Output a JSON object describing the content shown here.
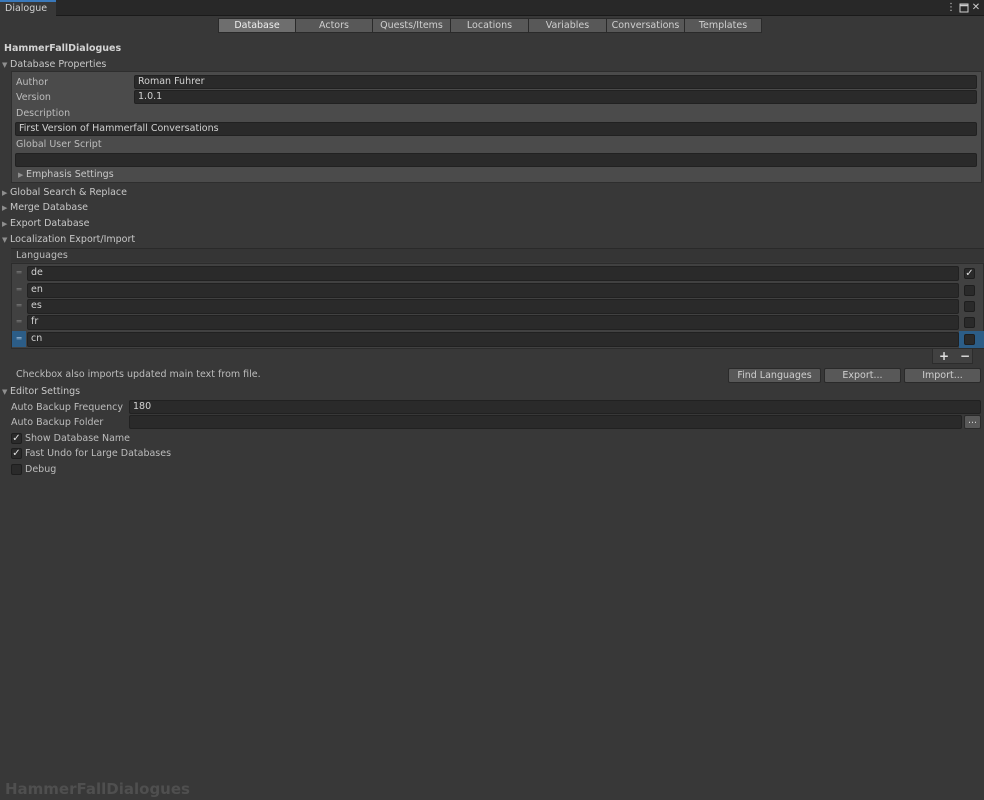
{
  "window": {
    "tab_title": "Dialogue",
    "menu_icon": "kebab-menu-icon",
    "maximize_icon": "maximize-icon",
    "close_icon": "close-icon"
  },
  "toolbar": {
    "tabs": [
      "Database",
      "Actors",
      "Quests/Items",
      "Locations",
      "Variables",
      "Conversations",
      "Templates"
    ],
    "active": "Database"
  },
  "database": {
    "name": "HammerFallDialogues",
    "properties_label": "Database Properties",
    "author_label": "Author",
    "author_value": "Roman Fuhrer",
    "version_label": "Version",
    "version_value": "1.0.1",
    "description_label": "Description",
    "description_value": "First Version of Hammerfall Conversations",
    "global_script_label": "Global User Script",
    "global_script_value": "",
    "emphasis_label": "Emphasis Settings"
  },
  "sections": {
    "search_replace": "Global Search & Replace",
    "merge": "Merge Database",
    "export": "Export Database",
    "localization": "Localization Export/Import",
    "editor": "Editor Settings"
  },
  "localization": {
    "languages_label": "Languages",
    "languages": [
      {
        "code": "de",
        "checked": true
      },
      {
        "code": "en",
        "checked": false
      },
      {
        "code": "es",
        "checked": false
      },
      {
        "code": "fr",
        "checked": false
      },
      {
        "code": "cn",
        "checked": false
      }
    ],
    "add_label": "+",
    "remove_label": "−",
    "note": "Checkbox also imports updated main text from file.",
    "find_languages": "Find Languages",
    "export_button": "Export...",
    "import_button": "Import..."
  },
  "editor": {
    "backup_freq_label": "Auto Backup Frequency",
    "backup_freq_value": "180",
    "backup_folder_label": "Auto Backup Folder",
    "backup_folder_value": "",
    "browse_label": "...",
    "show_db_name_label": "Show Database Name",
    "show_db_name": true,
    "fast_undo_label": "Fast Undo for Large Databases",
    "fast_undo": true,
    "debug_label": "Debug",
    "debug": false
  },
  "watermark": "HammerFallDialogues",
  "colors": {
    "accent": "#3a79bb",
    "background": "#383838",
    "panel": "#4b4b4b",
    "field": "#2a2a2a"
  }
}
